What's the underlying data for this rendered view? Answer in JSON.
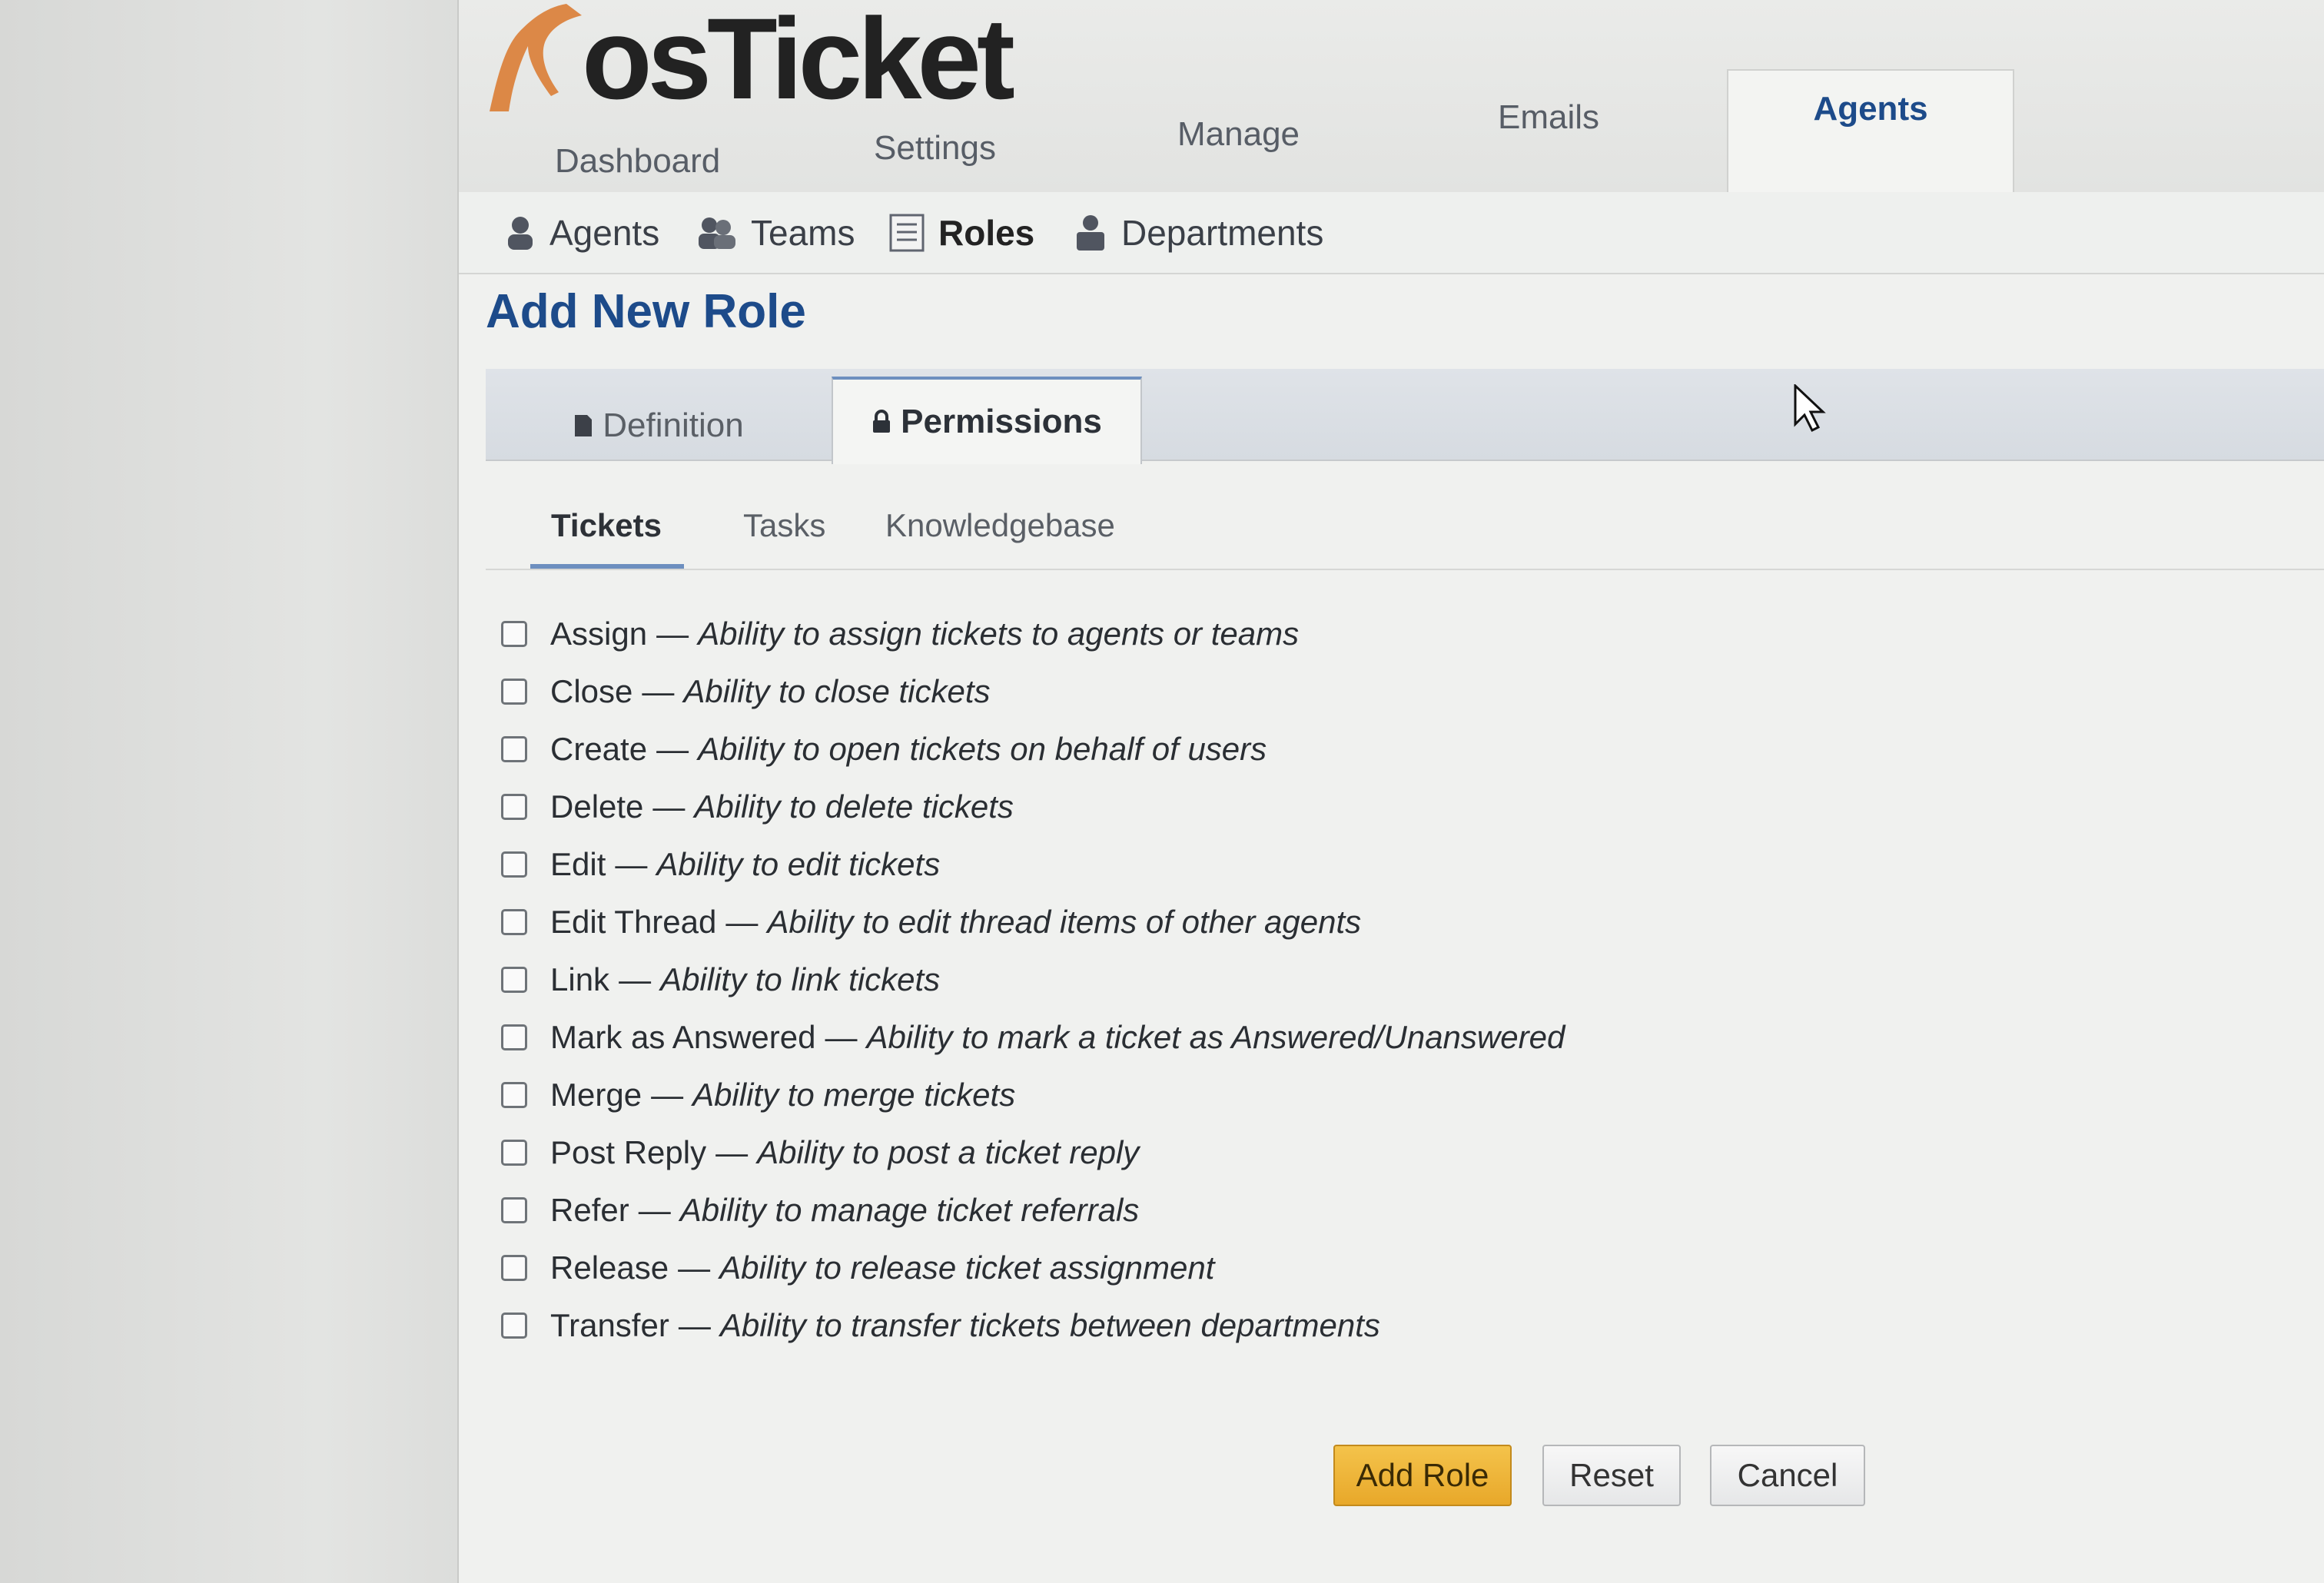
{
  "app": {
    "logo_text": "osTicket"
  },
  "nav": {
    "tabs": [
      {
        "label": "Dashboard"
      },
      {
        "label": "Settings"
      },
      {
        "label": "Manage"
      },
      {
        "label": "Emails"
      },
      {
        "label": "Agents",
        "active": true
      }
    ]
  },
  "subnav": {
    "items": [
      {
        "label": "Agents",
        "icon": "user-icon"
      },
      {
        "label": "Teams",
        "icon": "team-icon"
      },
      {
        "label": "Roles",
        "icon": "list-icon",
        "active": true
      },
      {
        "label": "Departments",
        "icon": "department-icon"
      }
    ]
  },
  "page": {
    "title": "Add New Role"
  },
  "form_tabs": [
    {
      "label": "Definition",
      "icon": "document-icon"
    },
    {
      "label": "Permissions",
      "icon": "lock-icon",
      "active": true
    }
  ],
  "subtabs": [
    {
      "label": "Tickets",
      "active": true
    },
    {
      "label": "Tasks"
    },
    {
      "label": "Knowledgebase"
    }
  ],
  "separator": "—",
  "permissions": [
    {
      "name": "Assign",
      "desc": "Ability to assign tickets to agents or teams",
      "checked": false
    },
    {
      "name": "Close",
      "desc": "Ability to close tickets",
      "checked": false
    },
    {
      "name": "Create",
      "desc": "Ability to open tickets on behalf of users",
      "checked": false
    },
    {
      "name": "Delete",
      "desc": "Ability to delete tickets",
      "checked": false
    },
    {
      "name": "Edit",
      "desc": "Ability to edit tickets",
      "checked": false
    },
    {
      "name": "Edit Thread",
      "desc": "Ability to edit thread items of other agents",
      "checked": false
    },
    {
      "name": "Link",
      "desc": "Ability to link tickets",
      "checked": false
    },
    {
      "name": "Mark as Answered",
      "desc": "Ability to mark a ticket as Answered/Unanswered",
      "checked": false
    },
    {
      "name": "Merge",
      "desc": "Ability to merge tickets",
      "checked": false
    },
    {
      "name": "Post Reply",
      "desc": "Ability to post a ticket reply",
      "checked": false
    },
    {
      "name": "Refer",
      "desc": "Ability to manage ticket referrals",
      "checked": false
    },
    {
      "name": "Release",
      "desc": "Ability to release ticket assignment",
      "checked": false
    },
    {
      "name": "Transfer",
      "desc": "Ability to transfer tickets between departments",
      "checked": false
    }
  ],
  "buttons": {
    "add": "Add Role",
    "reset": "Reset",
    "cancel": "Cancel"
  },
  "colors": {
    "accent": "#1d4b8a",
    "primary_button": "#f0b83d",
    "logo_orange": "#d9772a"
  }
}
